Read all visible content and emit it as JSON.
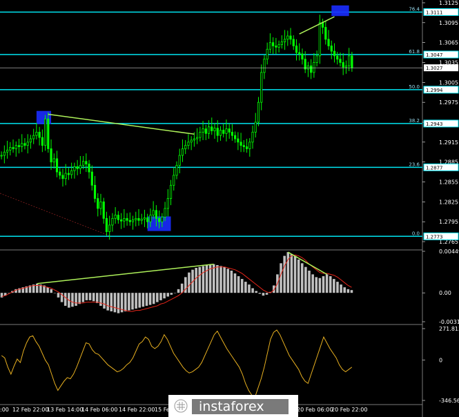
{
  "colors": {
    "background": "#000000",
    "candle": "#00ff00",
    "fib_line": "#00e5f2",
    "trend_line": "#aef25a",
    "highlight_box": "#1a2cff",
    "signal_line": "#e8261a",
    "osc_line": "#e8b020",
    "histogram": "#c0c0c0",
    "divider": "#7a7a7a",
    "dotted": "#6f1a1a"
  },
  "chart_data": [
    {
      "type": "candlestick",
      "pair_hint": "GBP/USD H1",
      "ylim": [
        1.2765,
        1.3125
      ],
      "y_ticks": [
        "1.3125",
        "1.3095",
        "1.3065",
        "1.3035",
        "1.3005",
        "1.2975",
        "1.2945",
        "1.2915",
        "1.2885",
        "1.2855",
        "1.2825",
        "1.2795",
        "1.2765"
      ],
      "y_tick_values": [
        1.3125,
        1.3095,
        1.3065,
        1.3035,
        1.3005,
        1.2975,
        1.2945,
        1.2915,
        1.2885,
        1.2855,
        1.2825,
        1.2795,
        1.2765
      ],
      "fib_levels": [
        {
          "label": "76.4",
          "price_label": "1.3111",
          "price": 1.3111
        },
        {
          "label": "61.8",
          "price_label": "1.3047",
          "price": 1.3047
        },
        {
          "label": "50.0",
          "price_label": "1.2994",
          "price": 1.2994
        },
        {
          "label": "38.2",
          "price_label": "1.2943",
          "price": 1.2943
        },
        {
          "label": "23.6",
          "price_label": "1.2877",
          "price": 1.2877
        },
        {
          "label": "0.0",
          "price_label": "1.2773",
          "price": 1.2773
        }
      ],
      "current_price_label": "1.3027",
      "current_price": 1.3027,
      "trend_lines": [
        {
          "from_bar": 16,
          "from_price": 1.2957,
          "to_bar": 66,
          "to_price": 1.2927
        },
        {
          "from_bar": 102,
          "from_price": 1.3078,
          "to_bar": 114,
          "to_price": 1.3104
        }
      ],
      "highlight_boxes": [
        {
          "bar_start": 12,
          "bar_end": 17,
          "price_low": 1.2942,
          "price_high": 1.2962
        },
        {
          "bar_start": 50,
          "bar_end": 58,
          "price_low": 1.2781,
          "price_high": 1.2803
        },
        {
          "bar_start": 113,
          "bar_end": 119,
          "price_low": 1.3105,
          "price_high": 1.3121
        }
      ],
      "close_series": [
        1.2895,
        1.29,
        1.2903,
        1.2907,
        1.2905,
        1.291,
        1.2908,
        1.2913,
        1.291,
        1.2915,
        1.292,
        1.2925,
        1.293,
        1.2922,
        1.291,
        1.295,
        1.2905,
        1.2885,
        1.289,
        1.287,
        1.2865,
        1.286,
        1.2868,
        1.2866,
        1.2872,
        1.2878,
        1.2875,
        1.288,
        1.2886,
        1.2882,
        1.287,
        1.285,
        1.283,
        1.2815,
        1.2825,
        1.28,
        1.278,
        1.279,
        1.28,
        1.2805,
        1.2798,
        1.2796,
        1.28,
        1.2797,
        1.2795,
        1.2798,
        1.28,
        1.2797,
        1.2799,
        1.2801,
        1.2795,
        1.2805,
        1.2812,
        1.28,
        1.2795,
        1.2802,
        1.2815,
        1.283,
        1.285,
        1.2865,
        1.288,
        1.2895,
        1.2905,
        1.291,
        1.2915,
        1.2918,
        1.292,
        1.2922,
        1.293,
        1.2935,
        1.2928,
        1.2938,
        1.2932,
        1.2936,
        1.2925,
        1.2933,
        1.2928,
        1.2935,
        1.293,
        1.2925,
        1.292,
        1.2915,
        1.291,
        1.2908,
        1.2905,
        1.2915,
        1.293,
        1.2945,
        1.2975,
        1.302,
        1.304,
        1.3055,
        1.3065,
        1.306,
        1.3058,
        1.3062,
        1.3066,
        1.307,
        1.3075,
        1.307,
        1.306,
        1.305,
        1.3048,
        1.304,
        1.3025,
        1.303,
        1.302,
        1.3035,
        1.3045,
        1.3095,
        1.3088,
        1.307,
        1.306,
        1.3052,
        1.3045,
        1.304,
        1.3035,
        1.3028,
        1.303,
        1.3045,
        1.3027
      ],
      "x_tick_labels": [
        "13 Feb 14:00",
        "14 Feb 06:00",
        "14 Feb 22:00",
        "15 Feb",
        "20 Feb 06:00",
        "20 Feb 22:00"
      ],
      "x_tick_labels_partial": [
        "12 Feb 22:00",
        ":00"
      ]
    },
    {
      "type": "bar",
      "name": "MACD histogram with signal line",
      "ylim": [
        -0.00312,
        0.00449
      ],
      "y_ticks": [
        "0.00449",
        "0.00",
        "-0.00312"
      ],
      "y_tick_values": [
        0.00449,
        0.0,
        -0.00312
      ],
      "values": [
        -0.0005,
        -0.0003,
        0.0,
        0.0002,
        0.0004,
        0.0005,
        0.0006,
        0.0007,
        0.0008,
        0.0009,
        0.001,
        0.0009,
        0.0008,
        0.0006,
        0.0004,
        0.0,
        -0.0005,
        -0.001,
        -0.0014,
        -0.0016,
        -0.0015,
        -0.0014,
        -0.0012,
        -0.001,
        -0.0008,
        -0.0008,
        -0.0009,
        -0.0011,
        -0.0014,
        -0.0017,
        -0.0019,
        -0.002,
        -0.0021,
        -0.0022,
        -0.0021,
        -0.002,
        -0.0019,
        -0.0018,
        -0.0017,
        -0.0016,
        -0.0015,
        -0.0014,
        -0.0013,
        -0.0012,
        -0.001,
        -0.0008,
        -0.0006,
        -0.0004,
        -0.0002,
        0.0,
        0.0004,
        0.001,
        0.0017,
        0.0022,
        0.0025,
        0.0027,
        0.0028,
        0.0029,
        0.003,
        0.0031,
        0.0031,
        0.003,
        0.0029,
        0.0028,
        0.0026,
        0.0024,
        0.0021,
        0.0018,
        0.0015,
        0.0012,
        0.0009,
        0.0005,
        0.0002,
        -0.0001,
        -0.0003,
        -0.0002,
        0.0001,
        0.0008,
        0.002,
        0.0032,
        0.004,
        0.0044,
        0.0042,
        0.004,
        0.0036,
        0.0032,
        0.0028,
        0.0024,
        0.002,
        0.0017,
        0.0016,
        0.0018,
        0.002,
        0.0018,
        0.0015,
        0.0012,
        0.0009,
        0.0006,
        0.0004,
        0.0003
      ],
      "signal": [
        -0.0004,
        -0.0003,
        -0.0001,
        0.0001,
        0.0003,
        0.0004,
        0.0005,
        0.0006,
        0.0007,
        0.0008,
        0.0008,
        0.0008,
        0.0007,
        0.0006,
        0.0005,
        0.0003,
        0.0001,
        -0.0002,
        -0.0005,
        -0.0008,
        -0.001,
        -0.0011,
        -0.0011,
        -0.0011,
        -0.001,
        -0.001,
        -0.001,
        -0.001,
        -0.0011,
        -0.0012,
        -0.0014,
        -0.0015,
        -0.0016,
        -0.0017,
        -0.0018,
        -0.0019,
        -0.002,
        -0.002,
        -0.0019,
        -0.0019,
        -0.0018,
        -0.0017,
        -0.0016,
        -0.0015,
        -0.0014,
        -0.0012,
        -0.0011,
        -0.0009,
        -0.0007,
        -0.0005,
        -0.0003,
        0.0,
        0.0004,
        0.0008,
        0.0012,
        0.0016,
        0.0019,
        0.0022,
        0.0024,
        0.0026,
        0.0027,
        0.0028,
        0.0028,
        0.0028,
        0.0027,
        0.0026,
        0.0025,
        0.0023,
        0.0021,
        0.0018,
        0.0015,
        0.0012,
        0.0009,
        0.0006,
        0.0003,
        0.0001,
        0.0,
        0.0003,
        0.001,
        0.002,
        0.0029,
        0.0036,
        0.004,
        0.0041,
        0.004,
        0.0038,
        0.0035,
        0.0031,
        0.0028,
        0.0025,
        0.0022,
        0.0021,
        0.0021,
        0.002,
        0.0019,
        0.0017,
        0.0014,
        0.0011,
        0.0008,
        0.0006
      ],
      "trend_lines": [
        {
          "from_index": 10,
          "from_value": 0.001,
          "to_index": 60,
          "to_value": 0.0031
        },
        {
          "from_index": 81,
          "from_value": 0.0044,
          "to_index": 92,
          "to_value": 0.002
        }
      ]
    },
    {
      "type": "line",
      "name": "CCI oscillator",
      "ylim": [
        -346.563,
        271.813
      ],
      "y_ticks": [
        "271.813",
        "0",
        "-346.563"
      ],
      "y_tick_values": [
        271.813,
        0,
        -346.563
      ],
      "values": [
        40,
        20,
        -60,
        -120,
        -50,
        10,
        -20,
        80,
        150,
        200,
        210,
        160,
        120,
        60,
        0,
        -40,
        -120,
        -200,
        -260,
        -220,
        -180,
        -150,
        -160,
        -120,
        -60,
        10,
        80,
        150,
        140,
        90,
        60,
        50,
        20,
        -10,
        -40,
        -60,
        -80,
        -100,
        -90,
        -70,
        -40,
        -20,
        20,
        80,
        140,
        160,
        200,
        180,
        120,
        100,
        120,
        160,
        220,
        180,
        120,
        60,
        20,
        -20,
        -60,
        -90,
        -110,
        -100,
        -80,
        -60,
        -20,
        40,
        100,
        160,
        220,
        250,
        200,
        150,
        100,
        60,
        20,
        -20,
        -60,
        -120,
        -200,
        -260,
        -300,
        -320,
        -240,
        -160,
        -60,
        60,
        180,
        240,
        260,
        220,
        160,
        100,
        40,
        0,
        -40,
        -80,
        -140,
        -180,
        -200,
        -120,
        -40,
        40,
        120,
        200,
        150,
        100,
        60,
        20,
        -40,
        -80,
        -100,
        -80,
        -60
      ]
    }
  ],
  "watermark": {
    "brand": "instaforex"
  }
}
